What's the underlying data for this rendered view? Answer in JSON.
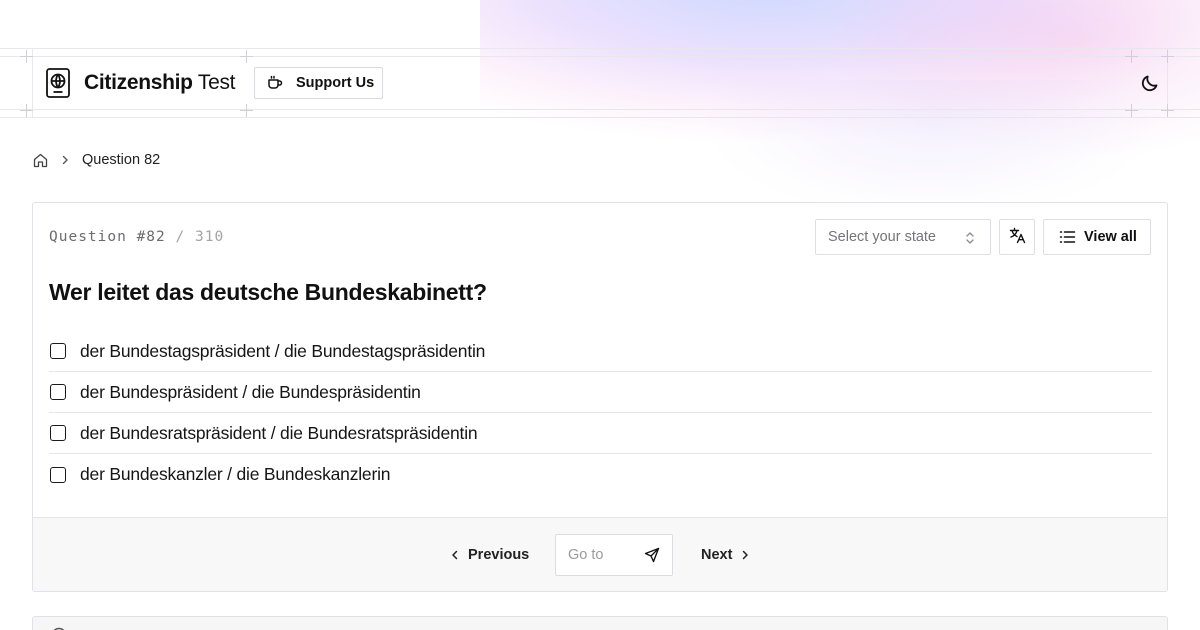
{
  "header": {
    "brand_bold": "Citizenship",
    "brand_light": "Test",
    "support_label": "Support Us"
  },
  "breadcrumb": {
    "current": "Question 82"
  },
  "question": {
    "label": "Question",
    "number_text": "#82",
    "separator": "/",
    "total": "310",
    "text": "Wer leitet das deutsche Bundeskabinett?",
    "answers": [
      "der Bundestagspräsident / die Bundestagspräsidentin",
      "der Bundespräsident / die Bundespräsidentin",
      "der Bundesratspräsident / die Bundesratspräsidentin",
      "der Bundeskanzler / die Bundeskanzlerin"
    ]
  },
  "toolbar": {
    "state_placeholder": "Select your state",
    "view_all_label": "View all"
  },
  "pagination": {
    "previous_label": "Previous",
    "goto_placeholder": "Go to",
    "next_label": "Next"
  },
  "icons": {
    "logo": "passport-globe-icon",
    "support": "coffee-cup-icon",
    "theme": "moon-icon",
    "home": "home-icon",
    "translate": "translate-icon",
    "view_all": "list-icon",
    "send": "send-icon"
  }
}
